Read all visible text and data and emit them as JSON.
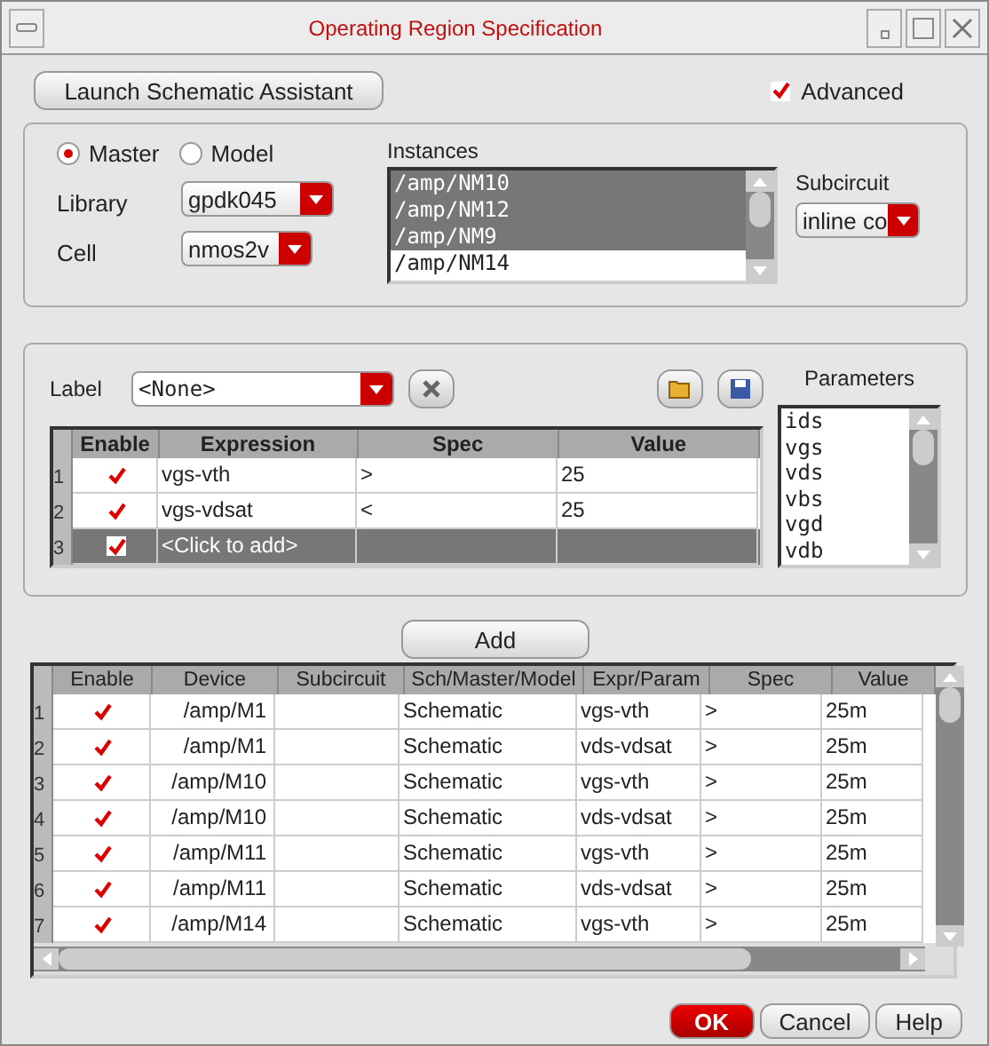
{
  "window": {
    "title": "Operating Region Specification"
  },
  "launch_button": {
    "label": "Launch Schematic Assistant"
  },
  "advanced": {
    "label": "Advanced",
    "checked": true
  },
  "scope": [
    {
      "label": "Master",
      "selected": true
    },
    {
      "label": "Model",
      "selected": false
    }
  ],
  "library": {
    "label": "Library",
    "value": "gpdk045"
  },
  "cell": {
    "label": "Cell",
    "value": "nmos2v"
  },
  "instances": {
    "label": "Instances",
    "items": [
      {
        "text": "/amp/NM10",
        "selected": true
      },
      {
        "text": "/amp/NM12",
        "selected": true
      },
      {
        "text": "/amp/NM9",
        "selected": true
      },
      {
        "text": "/amp/NM14",
        "selected": false
      }
    ]
  },
  "subcircuit": {
    "label": "Subcircuit",
    "value": "inline co"
  },
  "label_field": {
    "label": "Label",
    "value": "<None>"
  },
  "parameters": {
    "label": "Parameters",
    "items": [
      "ids",
      "vgs",
      "vds",
      "vbs",
      "vgd",
      "vdb"
    ]
  },
  "expressions": {
    "columns": [
      "Enable",
      "Expression",
      "Spec",
      "Value"
    ],
    "rows": [
      {
        "number": "1",
        "enabled": true,
        "expression": "vgs-vth",
        "spec": ">",
        "value": "25",
        "selected": false
      },
      {
        "number": "2",
        "enabled": true,
        "expression": "vgs-vdsat",
        "spec": "<",
        "value": "25",
        "selected": false
      },
      {
        "number": "3",
        "enabled": true,
        "expression": "<Click to add>",
        "selected": true
      }
    ]
  },
  "add_button": {
    "label": "Add"
  },
  "results": {
    "columns": [
      "Enable",
      "Device",
      "Subcircuit",
      "Sch/Master/Model",
      "Expr/Param",
      "Spec",
      "Value"
    ],
    "rows": [
      {
        "number": "1",
        "enabled": true,
        "device": "/amp/M1",
        "model": "Schematic",
        "expr": "vgs-vth",
        "spec": ">",
        "value": "25m"
      },
      {
        "number": "2",
        "enabled": true,
        "device": "/amp/M1",
        "model": "Schematic",
        "expr": "vds-vdsat",
        "spec": ">",
        "value": "25m"
      },
      {
        "number": "3",
        "enabled": true,
        "device": "/amp/M10",
        "model": "Schematic",
        "expr": "vgs-vth",
        "spec": ">",
        "value": "25m"
      },
      {
        "number": "4",
        "enabled": true,
        "device": "/amp/M10",
        "model": "Schematic",
        "expr": "vds-vdsat",
        "spec": ">",
        "value": "25m"
      },
      {
        "number": "5",
        "enabled": true,
        "device": "/amp/M11",
        "model": "Schematic",
        "expr": "vgs-vth",
        "spec": ">",
        "value": "25m"
      },
      {
        "number": "6",
        "enabled": true,
        "device": "/amp/M11",
        "model": "Schematic",
        "expr": "vds-vdsat",
        "spec": ">",
        "value": "25m"
      },
      {
        "number": "7",
        "enabled": true,
        "device": "/amp/M14",
        "model": "Schematic",
        "expr": "vgs-vth",
        "spec": ">",
        "value": "25m"
      }
    ]
  },
  "buttons": [
    {
      "label": "OK",
      "kind": "primary"
    },
    {
      "label": "Cancel",
      "kind": "normal"
    },
    {
      "label": "Help",
      "kind": "normal"
    }
  ]
}
